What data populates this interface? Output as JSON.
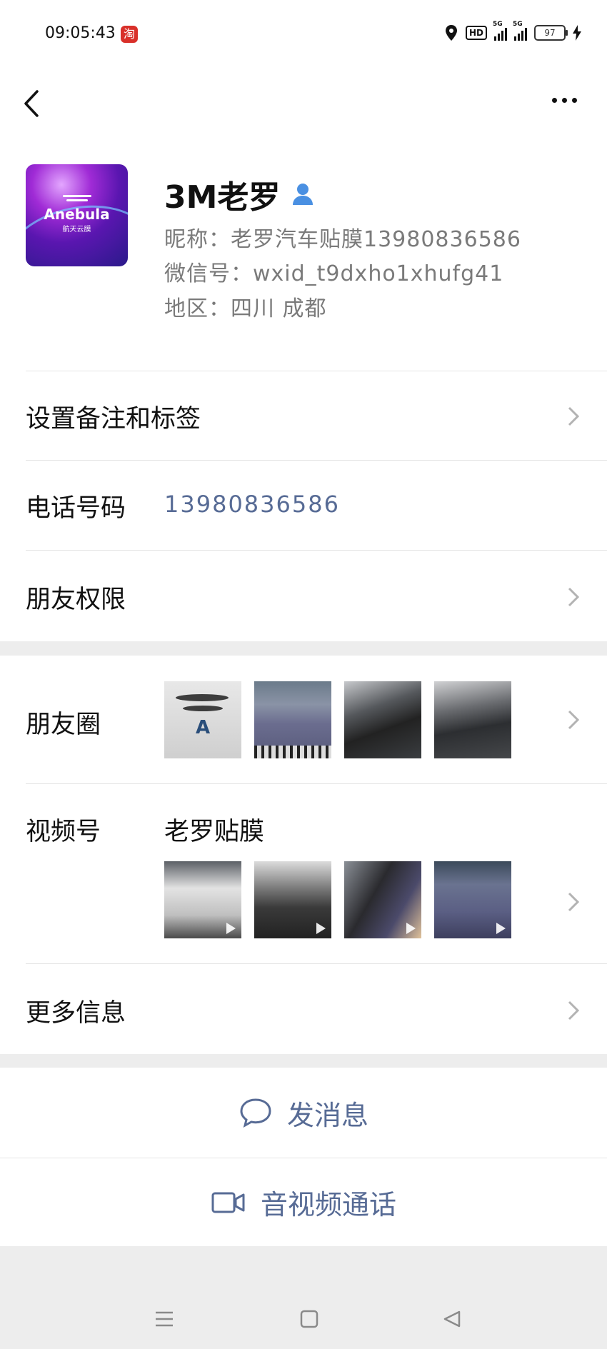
{
  "status_bar": {
    "time": "09:05:43",
    "taobao_icon": "淘",
    "network_1": "5G",
    "network_2": "5G",
    "hd_label": "HD",
    "battery": "97"
  },
  "profile": {
    "avatar_brand": "Anebula",
    "avatar_sub": "航天云膜",
    "name": "3M老罗",
    "nickname": "昵称：老罗汽车贴膜13980836586",
    "wechat_id": "微信号：wxid_t9dxho1xhufg41",
    "region": "地区：四川  成都"
  },
  "rows": {
    "remark_label": "设置备注和标签",
    "phone_label": "电话号码",
    "phone_value": "13980836586",
    "permission_label": "朋友权限",
    "moments_label": "朋友圈",
    "channels_label": "视频号",
    "channels_name": "老罗贴膜",
    "more_label": "更多信息"
  },
  "actions": {
    "message": "发消息",
    "call": "音视频通话"
  },
  "colors": {
    "link_blue": "#576b95",
    "verify_blue": "#4a90e2",
    "background": "#ededed"
  }
}
